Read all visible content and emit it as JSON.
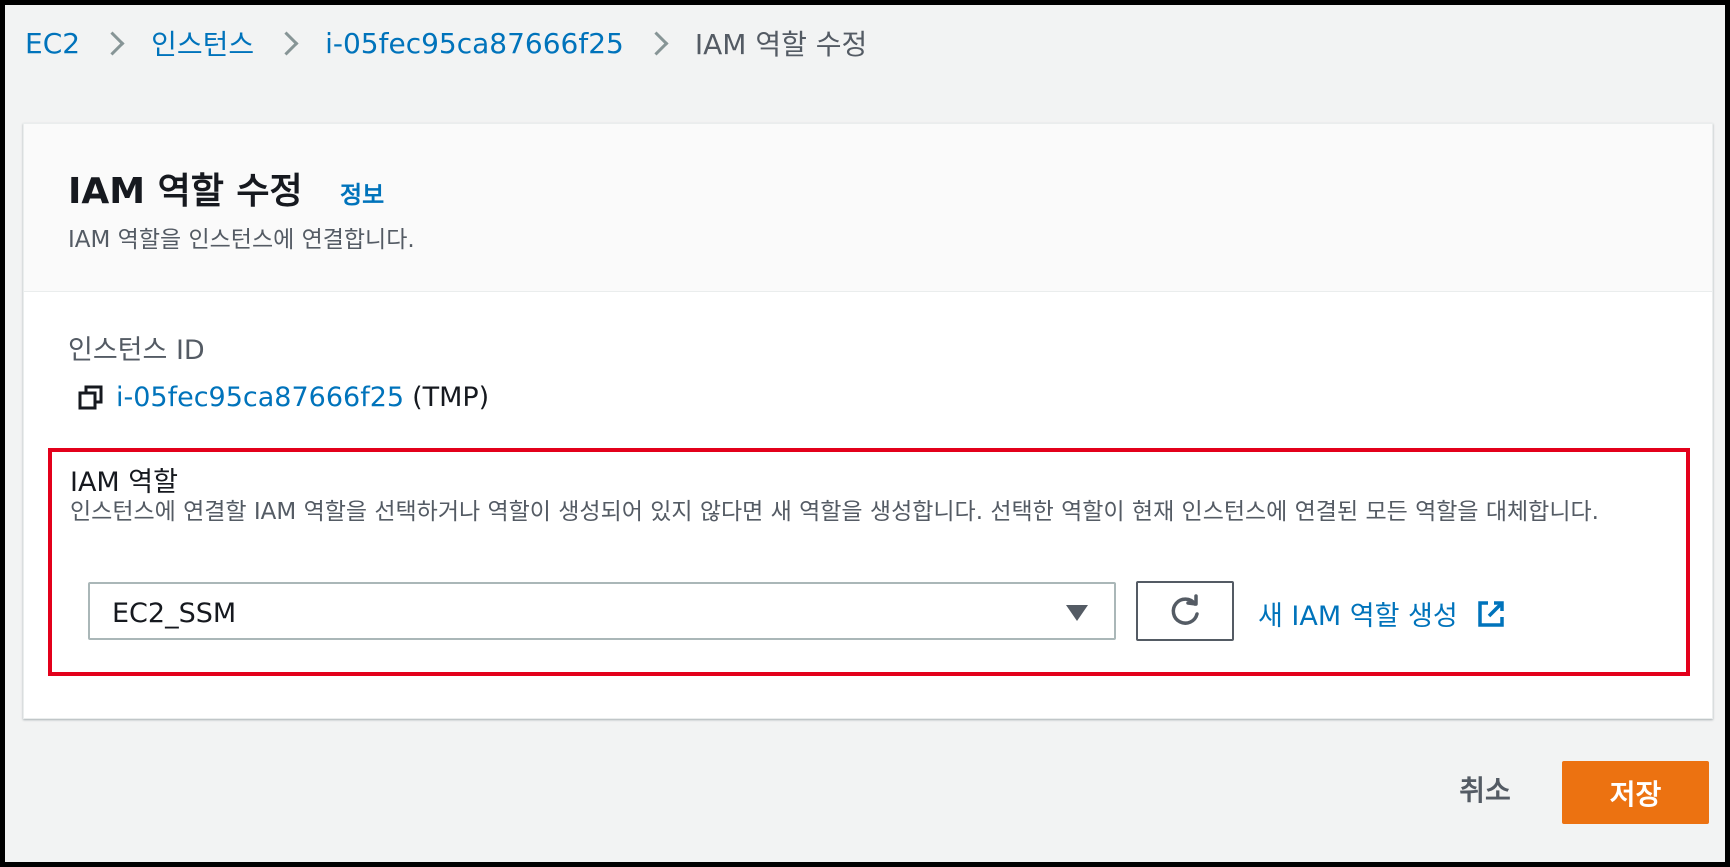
{
  "breadcrumb": {
    "items": [
      {
        "label": "EC2"
      },
      {
        "label": "인스턴스"
      },
      {
        "label": "i-05fec95ca87666f25"
      },
      {
        "label": "IAM 역할 수정"
      }
    ]
  },
  "panel": {
    "title": "IAM 역할 수정",
    "info_link": "정보",
    "description": "IAM 역할을 인스턴스에 연결합니다."
  },
  "instance": {
    "label": "인스턴스 ID",
    "id": "i-05fec95ca87666f25",
    "suffix": "(TMP)"
  },
  "iam_role": {
    "label": "IAM 역할",
    "description": "인스턴스에 연결할 IAM 역할을 선택하거나 역할이 생성되어 있지 않다면 새 역할을 생성합니다. 선택한 역할이 현재 인스턴스에 연결된 모든 역할을 대체합니다.",
    "selected": "EC2_SSM",
    "create_link": "새 IAM 역할 생성"
  },
  "actions": {
    "cancel": "취소",
    "save": "저장"
  },
  "icons": {
    "copy": "copy-icon",
    "refresh": "refresh-icon",
    "external": "external-link-icon",
    "caret": "caret-down-icon",
    "chevron": "chevron-right-icon"
  },
  "colors": {
    "link": "#0073bb",
    "primary_button": "#ec7211",
    "highlight_border": "#e3001b",
    "page_background": "#f2f3f3"
  }
}
